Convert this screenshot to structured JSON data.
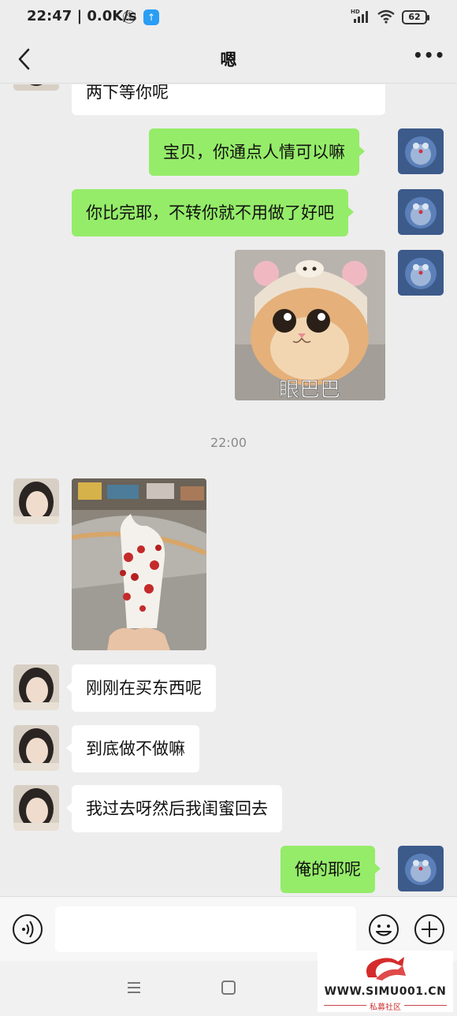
{
  "status_bar": {
    "time": "22:47 | 0.0K/s",
    "network_badge": "HD",
    "battery": "62",
    "icons": [
      "bell-muted-icon",
      "upload-icon",
      "signal-icon",
      "wifi-icon",
      "battery-icon"
    ]
  },
  "header": {
    "title": "嗯",
    "back_icon": "chevron-left-icon",
    "more_icon": "more-dots-icon"
  },
  "messages": [
    {
      "side": "left",
      "type": "text",
      "text": "两下等你呢"
    },
    {
      "side": "right",
      "type": "text",
      "text": "宝贝，你通点人情可以嘛"
    },
    {
      "side": "right",
      "type": "text",
      "text": "你比完耶，不转你就不用做了好吧"
    },
    {
      "side": "right",
      "type": "sticker",
      "caption": "眼巴巴"
    },
    {
      "type": "timestamp",
      "text": "22:00"
    },
    {
      "side": "left",
      "type": "photo",
      "subject": "ice cream cone with red topping in shopping mall"
    },
    {
      "side": "left",
      "type": "text",
      "text": "刚刚在买东西呢"
    },
    {
      "side": "left",
      "type": "text",
      "text": "到底做不做嘛"
    },
    {
      "side": "left",
      "type": "text",
      "text": "我过去呀然后我闺蜜回去"
    },
    {
      "side": "right",
      "type": "text",
      "text": "俺的耶呢"
    }
  ],
  "input_bar": {
    "value": "",
    "icons": [
      "voice-icon",
      "emoji-icon",
      "plus-icon"
    ]
  },
  "nav_bar": {
    "icons": [
      "menu-icon",
      "home-icon"
    ]
  },
  "watermark": {
    "site": "WWW.SIMU001.CN",
    "subtitle": "私募社区"
  },
  "colors": {
    "background": "#ededed",
    "green_bubble": "#95ec69",
    "white_bubble": "#ffffff",
    "timestamp": "#8a8a8a"
  }
}
